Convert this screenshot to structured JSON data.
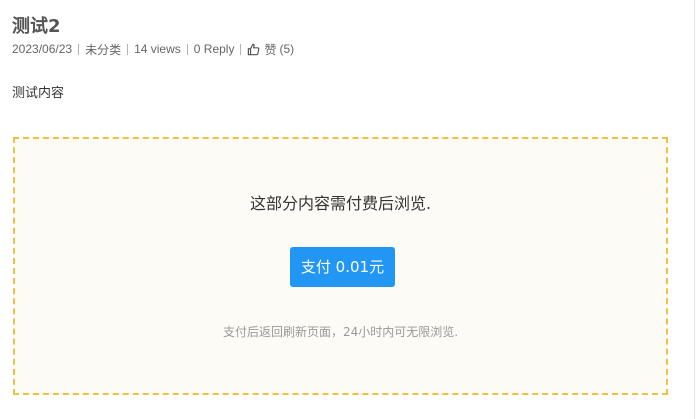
{
  "post": {
    "title": "测试2",
    "meta": {
      "date": "2023/06/23",
      "category": "未分类",
      "views": "14 views",
      "replies": "0 Reply",
      "like_label": "赞",
      "like_count": "(5)",
      "like_icon": "thumbs-up-icon"
    },
    "content": "测试内容"
  },
  "paywall": {
    "notice": "这部分内容需付费后浏览.",
    "pay_button_label": "支付 0.01元",
    "hint": "支付后返回刷新页面，24小时内可无限浏览.",
    "border_color": "#f0c040",
    "background_color": "#fdfbf5",
    "button_color": "#2196f3"
  }
}
